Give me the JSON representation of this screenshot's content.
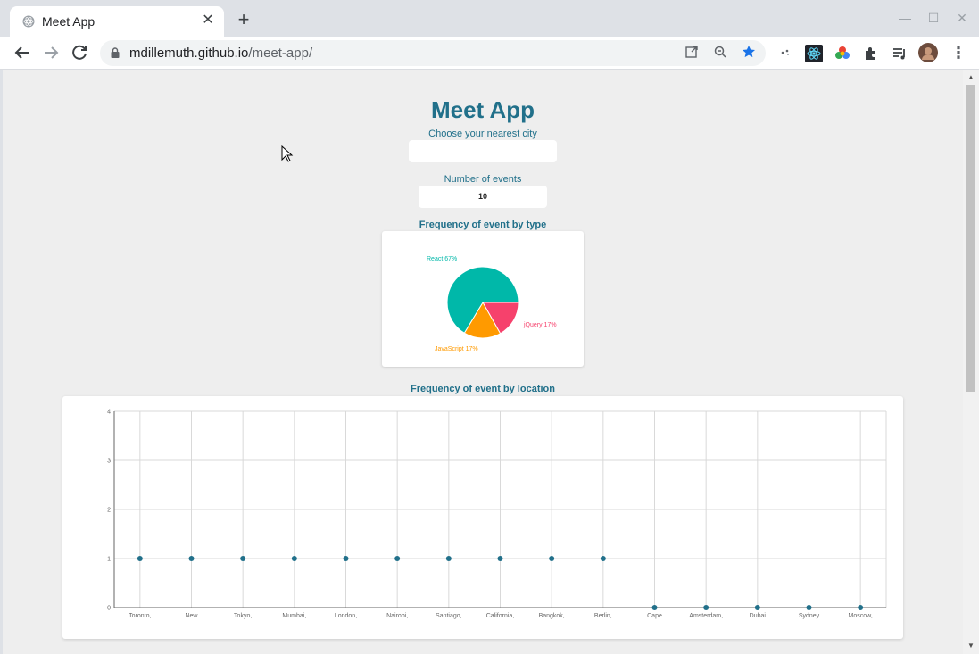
{
  "browser": {
    "tab_title": "Meet App",
    "url_host": "mdillemuth.github.io",
    "url_path": "/meet-app/"
  },
  "app": {
    "title": "Meet App",
    "city_label": "Choose your nearest city",
    "city_value": "",
    "events_label": "Number of events",
    "events_value": "10"
  },
  "colors": {
    "accent": "#21708a",
    "react": "#00b8a9",
    "jquery": "#f6416c",
    "javascript": "#ff9a00",
    "point": "#21708a"
  },
  "chart_data": [
    {
      "type": "pie",
      "title": "Frequency of event by type",
      "slices": [
        {
          "name": "React",
          "value": 67,
          "label": "React 67%",
          "color": "#00b8a9"
        },
        {
          "name": "jQuery",
          "value": 17,
          "label": "jQuery 17%",
          "color": "#f6416c"
        },
        {
          "name": "JavaScript",
          "value": 17,
          "label": "JavaScript 17%",
          "color": "#ff9a00"
        }
      ]
    },
    {
      "type": "scatter",
      "title": "Frequency of event by location",
      "categories": [
        "Toronto,",
        "New",
        "Tokyo,",
        "Mumbai,",
        "London,",
        "Nairobi,",
        "Santiago,",
        "California,",
        "Bangkok,",
        "Berlin,",
        "Cape",
        "Amsterdam,",
        "Dubai",
        "Sydney",
        "Moscow,"
      ],
      "values": [
        1,
        1,
        1,
        1,
        1,
        1,
        1,
        1,
        1,
        1,
        0,
        0,
        0,
        0,
        0
      ],
      "yticks": [
        "0",
        "1",
        "2",
        "3",
        "4"
      ],
      "ylim": [
        0,
        4
      ],
      "grid": true
    }
  ]
}
